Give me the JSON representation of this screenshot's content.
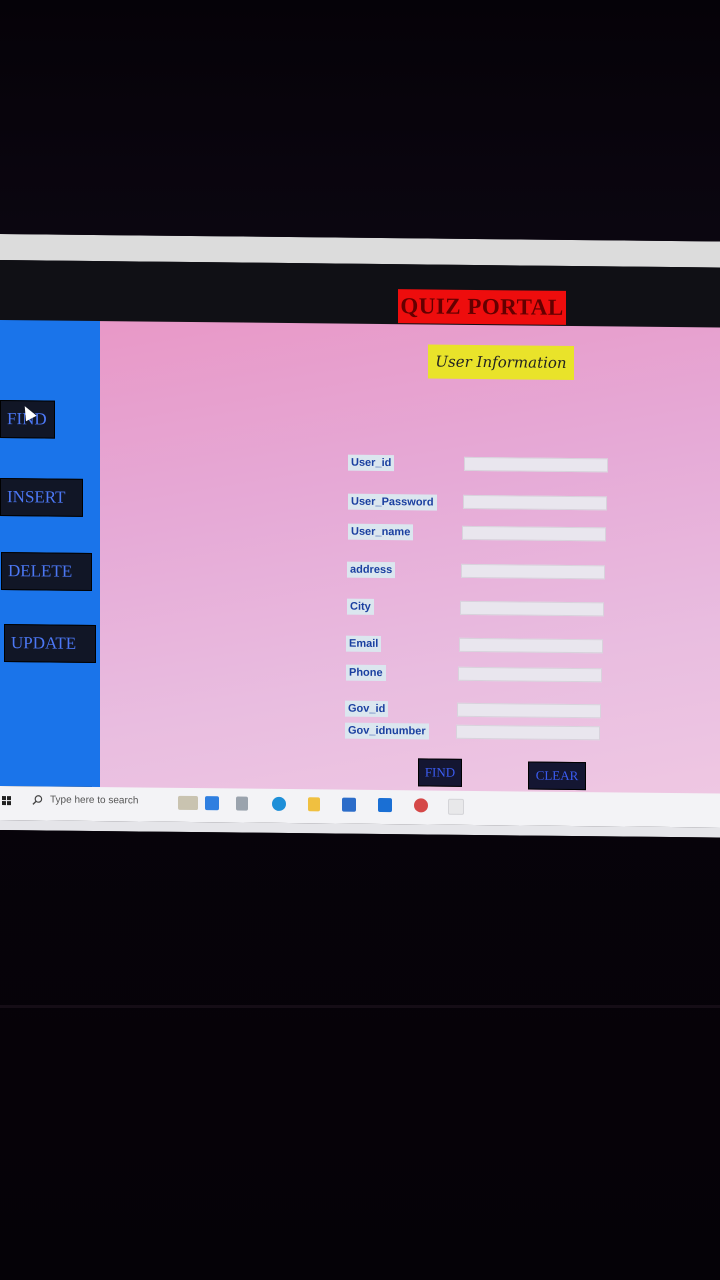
{
  "app": {
    "title": "QUIZ PORTAL",
    "section_title": "User Information"
  },
  "sidebar": {
    "items": [
      {
        "label": "FIND"
      },
      {
        "label": "INSERT"
      },
      {
        "label": "DELETE"
      },
      {
        "label": "UPDATE"
      }
    ]
  },
  "form": {
    "fields": [
      {
        "label": "User_id",
        "value": ""
      },
      {
        "label": "User_Password",
        "value": ""
      },
      {
        "label": "User_name",
        "value": ""
      },
      {
        "label": "address",
        "value": ""
      },
      {
        "label": "City",
        "value": ""
      },
      {
        "label": "Email",
        "value": ""
      },
      {
        "label": "Phone",
        "value": ""
      },
      {
        "label": "Gov_id",
        "value": ""
      },
      {
        "label": "Gov_idnumber",
        "value": ""
      }
    ],
    "find_label": "FIND",
    "clear_label": "CLEAR"
  },
  "taskbar": {
    "search_placeholder": "Type here to search"
  },
  "colors": {
    "sidebar": "#1a74ea",
    "title_bg": "#ee0d0d",
    "section_bg": "#e9e32a",
    "content_bg": "#e6a9d6"
  }
}
